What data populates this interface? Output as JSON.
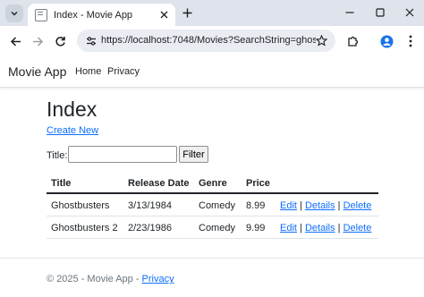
{
  "browser": {
    "tab_title": "Index - Movie App",
    "url": "https://localhost:7048/Movies?SearchString=ghost"
  },
  "app": {
    "brand": "Movie App",
    "nav": {
      "home": "Home",
      "privacy": "Privacy"
    }
  },
  "page": {
    "title": "Index",
    "create_link": "Create New",
    "filter": {
      "label": "Title:",
      "value": "",
      "button": "Filter"
    }
  },
  "table": {
    "headers": {
      "title": "Title",
      "release_date": "Release Date",
      "genre": "Genre",
      "price": "Price"
    },
    "rows": [
      {
        "title": "Ghostbusters",
        "release_date": "3/13/1984",
        "genre": "Comedy",
        "price": "8.99"
      },
      {
        "title": "Ghostbusters 2",
        "release_date": "2/23/1986",
        "genre": "Comedy",
        "price": "9.99"
      }
    ],
    "actions": {
      "edit": "Edit",
      "details": "Details",
      "delete": "Delete",
      "separator": "|"
    }
  },
  "footer": {
    "text": "© 2025 - Movie App - ",
    "privacy_link": "Privacy"
  },
  "colors": {
    "link": "#0d6efd",
    "tabstrip_bg": "#dfe3eb",
    "omnibox_bg": "#e9edf3"
  },
  "icons": {
    "tab_list": "chevron-down-icon",
    "favicon": "page-icon",
    "tab_close": "close-icon",
    "new_tab": "plus-icon",
    "minimize": "minimize-icon",
    "maximize": "maximize-icon",
    "close_window": "close-icon",
    "back": "arrow-left-icon",
    "forward": "arrow-right-icon",
    "reload": "reload-icon",
    "site_info": "tune-icon",
    "bookmark": "star-icon",
    "extensions": "puzzle-icon",
    "profile": "avatar-icon",
    "menu": "kebab-menu-icon"
  }
}
